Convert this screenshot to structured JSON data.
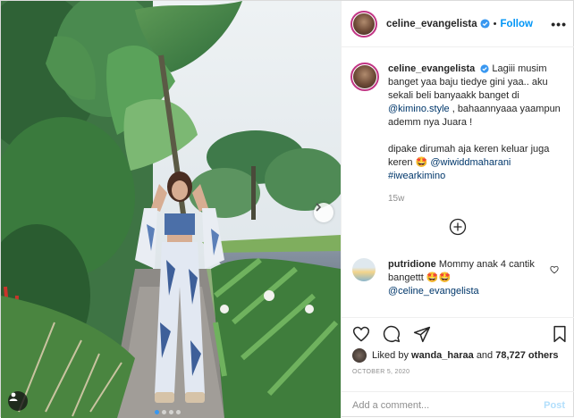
{
  "header": {
    "username": "celine_evangelista",
    "follow_label": "Follow",
    "more_label": "•••"
  },
  "caption": {
    "username": "celine_evangelista",
    "text_1": "Lagiii musim banget yaa baju tiedye gini yaa.. aku sekali beli banyaakk banget di",
    "mention_1": "@kimino.style",
    "text_2": ", bahaannyaaa yaampun ademm nya Juara !",
    "text_3": "dipake dirumah aja keren keluar juga keren 🤩",
    "mention_2": "@wiwiddmaharani",
    "hashtag": "#iwearkimino",
    "time": "15w"
  },
  "reply": {
    "username": "putridione",
    "text": "Mommy anak 4 cantik bangettt 🤩🤩",
    "mention": "@celine_evangelista"
  },
  "likes": {
    "prefix": "Liked by",
    "user": "wanda_haraa",
    "and": "and",
    "count": "78,727 others"
  },
  "date": "OCTOBER 5, 2020",
  "comment_box": {
    "placeholder": "Add a comment...",
    "post_label": "Post"
  },
  "carousel": {
    "current": 1,
    "total": 4
  },
  "colors": {
    "accent": "#0095f6",
    "story_ring": "#c13584",
    "post_disabled": "#b2dffc"
  }
}
